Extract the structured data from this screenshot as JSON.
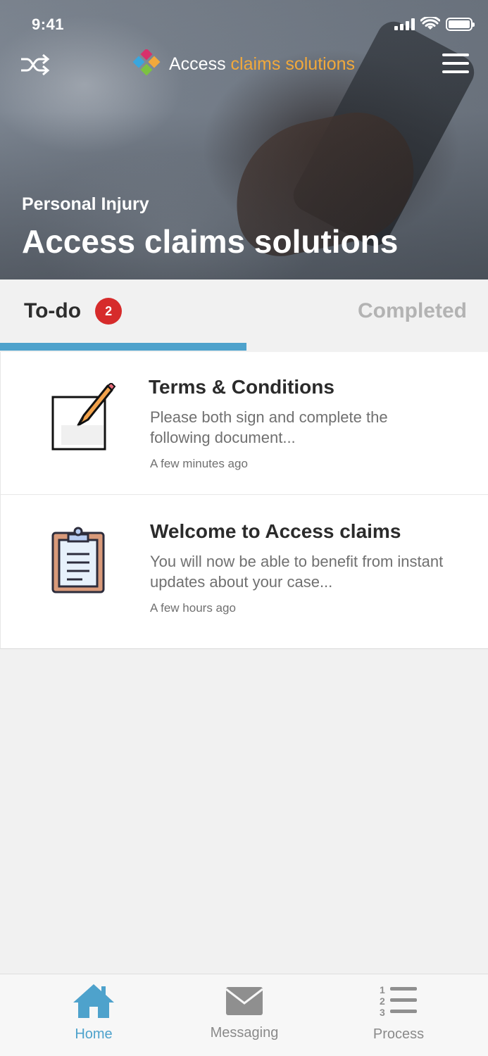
{
  "status_bar": {
    "time": "9:41"
  },
  "header": {
    "brand_main": "Access",
    "brand_accent": "claims solutions",
    "subtitle": "Personal Injury",
    "title": "Access claims solutions",
    "left_icon": "shuffle-icon",
    "right_icon": "hamburger-menu-icon"
  },
  "tabs": {
    "todo_label": "To-do",
    "todo_count": "2",
    "completed_label": "Completed",
    "active": "To-do"
  },
  "items": [
    {
      "title": "Terms & Conditions",
      "body": "Please both sign and complete the following document...",
      "time": "A few minutes ago",
      "icon": "edit-document-icon"
    },
    {
      "title": "Welcome to Access claims",
      "body": "You will now be able to benefit from instant updates about your case...",
      "time": "A few hours ago",
      "icon": "clipboard-icon"
    }
  ],
  "bottom_nav": [
    {
      "label": "Home",
      "icon": "home-icon",
      "active": true
    },
    {
      "label": "Messaging",
      "icon": "envelope-icon",
      "active": false
    },
    {
      "label": "Process",
      "icon": "numbered-list-icon",
      "active": false
    }
  ],
  "colors": {
    "accent_blue": "#4ea2cc",
    "badge_red": "#d62b2b",
    "brand_orange": "#f2a93b"
  }
}
